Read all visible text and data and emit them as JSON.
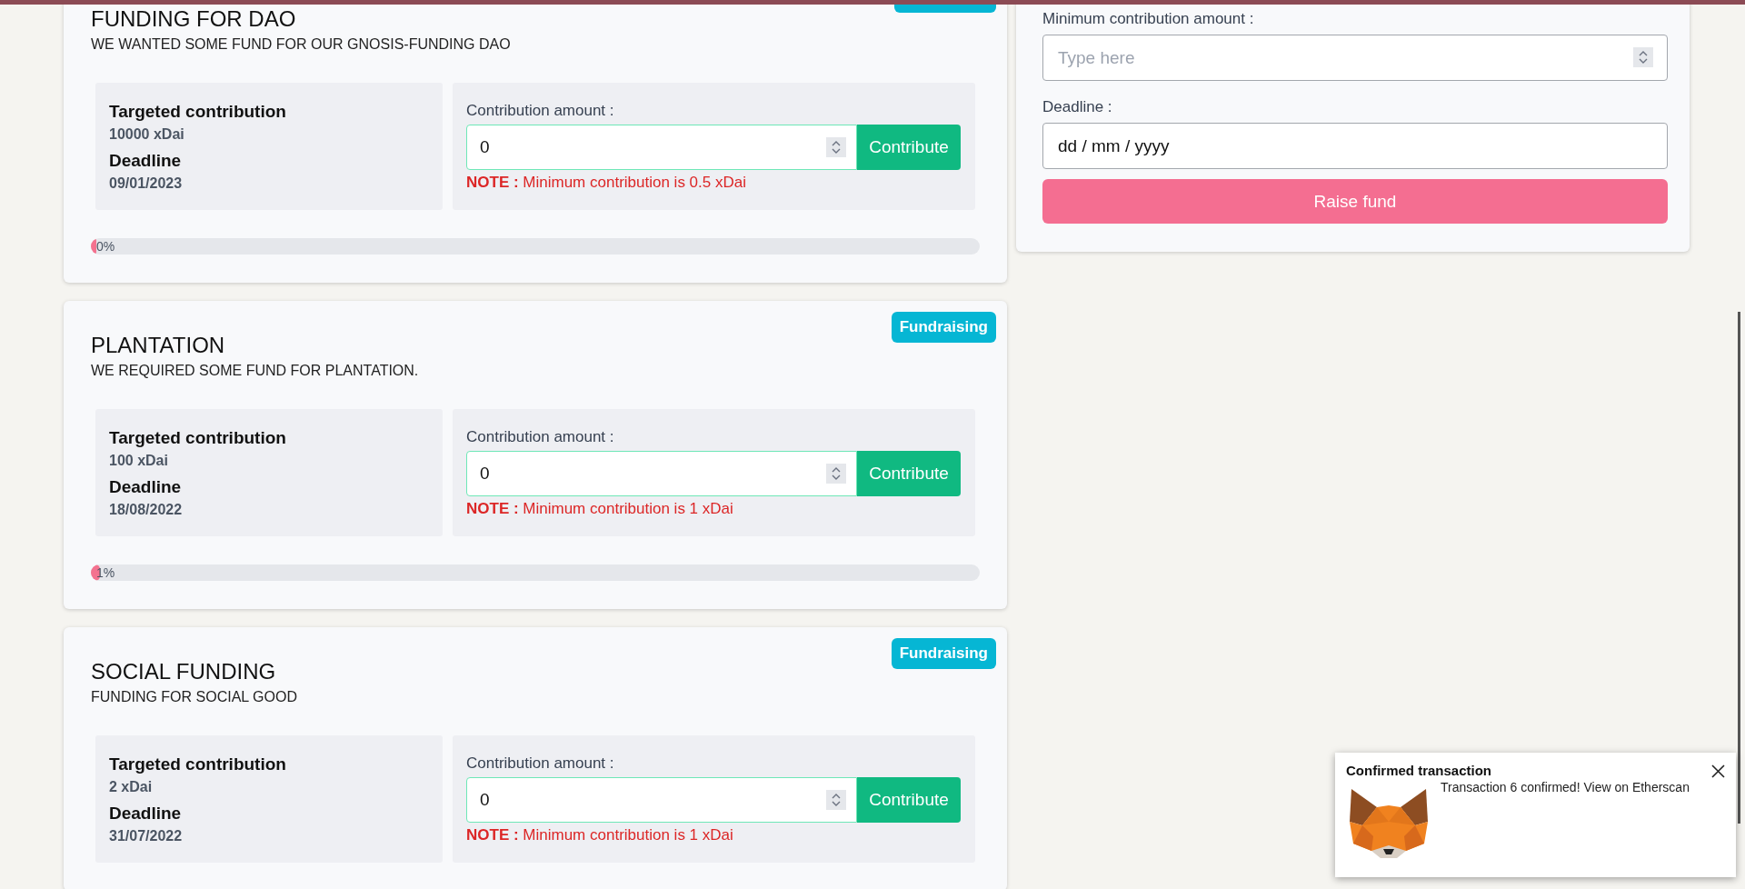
{
  "projects": [
    {
      "title": "FUNDING FOR DAO",
      "description": "WE WANTED SOME FUND FOR OUR GNOSIS-FUNDING DAO",
      "status": {
        "clipped": true
      },
      "target_label": "Targeted contribution",
      "target": "10000 xDai",
      "deadline_label": "Deadline",
      "deadline": "09/01/2023",
      "amount_label": "Contribution amount :",
      "amount": "0",
      "button": "Contribute",
      "note": "**NOTE :** Minimum contribution is 0.5 xDai",
      "progress": {
        "level": 0,
        "label": "0%"
      }
    },
    {
      "title": "PLANTATION",
      "description": "WE REQUIRED SOME FUND FOR PLANTATION.",
      "status": {
        "label": "Fundraising"
      },
      "target_label": "Targeted contribution",
      "target": "100 xDai",
      "deadline_label": "Deadline",
      "deadline": "18/08/2022",
      "amount_label": "Contribution amount :",
      "amount": "0",
      "button": "Contribute",
      "note": "**NOTE :** Minimum contribution is 1 xDai",
      "progress": {
        "level": 0.01,
        "label": "1%"
      }
    },
    {
      "title": "SOCIAL FUNDING",
      "description": "FUNDING FOR SOCIAL GOOD",
      "status": {
        "label": "Fundraising"
      },
      "target_label": "Targeted contribution",
      "target": "2 xDai",
      "deadline_label": "Deadline",
      "deadline": "31/07/2022",
      "amount_label": "Contribution amount :",
      "amount": "0",
      "button": "Contribute",
      "note": "**NOTE :** Minimum contribution is 1 xDai"
    }
  ],
  "create_form": {
    "min_label": "Minimum contribution amount :",
    "placeholder": "Type here",
    "deadline_label": "Deadline :",
    "deadline_value": "dd / mm / yyyy",
    "button": "Raise fund"
  },
  "notification": {
    "title": "Confirmed transaction",
    "message": "Transaction 6 confirmed! View on Etherscan"
  }
}
